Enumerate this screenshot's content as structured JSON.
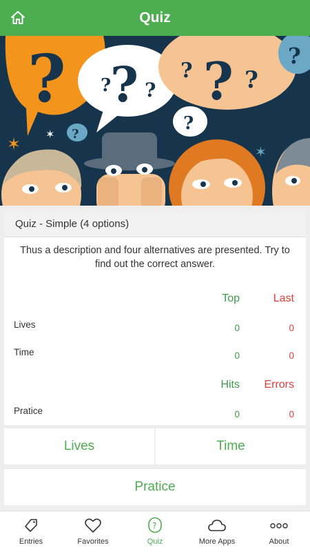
{
  "app_bar": {
    "title": "Quiz"
  },
  "card": {
    "title": "Quiz - Simple (4 options)",
    "description": "Thus a description and four alternatives are presented. Try to find out the correct answer.",
    "headers_1": {
      "top": "Top",
      "last": "Last"
    },
    "rows_1": [
      {
        "label": "Lives",
        "top": "0",
        "last": "0"
      },
      {
        "label": "Time",
        "top": "0",
        "last": "0"
      }
    ],
    "headers_2": {
      "hits": "Hits",
      "errors": "Errors"
    },
    "rows_2": [
      {
        "label": "Pratice",
        "hits": "0",
        "errors": "0"
      }
    ]
  },
  "buttons": {
    "lives": "Lives",
    "time": "Time",
    "practice": "Pratice"
  },
  "nav": [
    {
      "label": "Entries",
      "icon": "tag-icon"
    },
    {
      "label": "Favorites",
      "icon": "heart-icon"
    },
    {
      "label": "Quiz",
      "icon": "question-icon"
    },
    {
      "label": "More Apps",
      "icon": "cloud-icon"
    },
    {
      "label": "About",
      "icon": "dots-icon"
    }
  ],
  "colors": {
    "primary": "#4cae4f",
    "green_text": "#3e9a47",
    "red_text": "#e23b3b"
  }
}
